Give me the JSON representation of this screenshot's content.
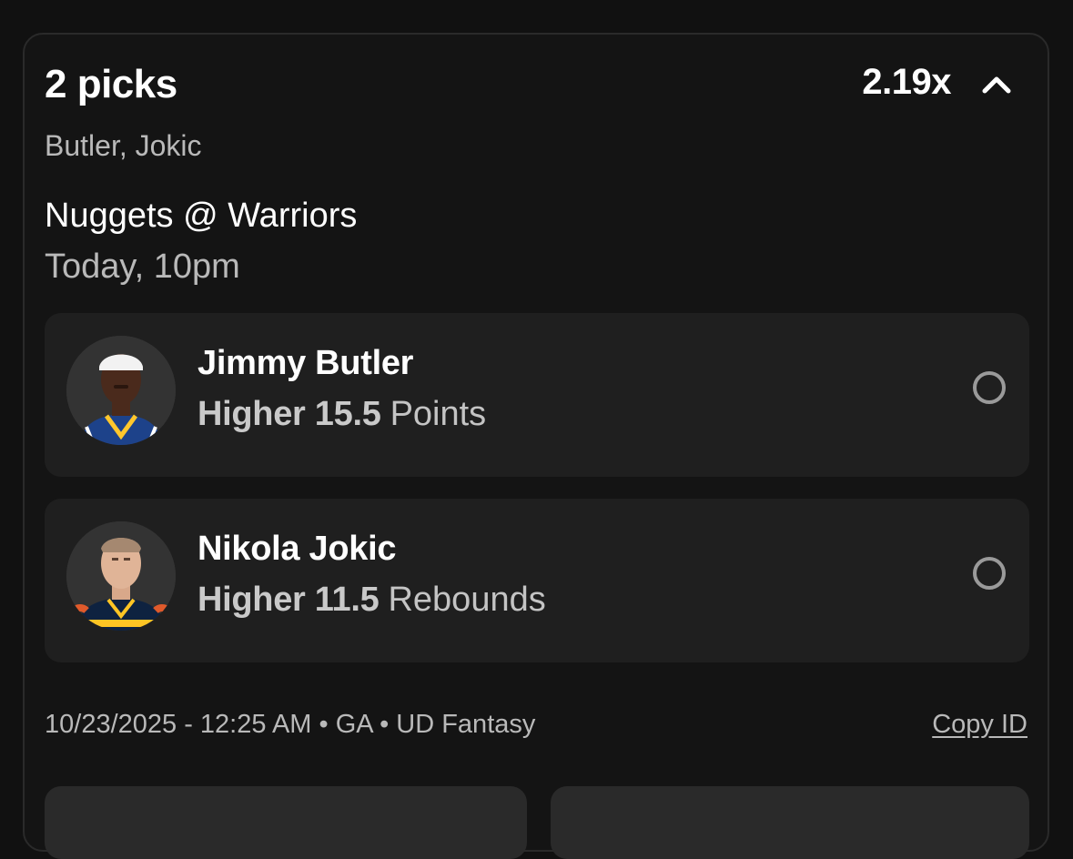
{
  "entry": {
    "picks_count_label": "2 picks",
    "multiplier": "2.19x",
    "players_summary": "Butler, Jokic",
    "matchup": "Nuggets @ Warriors",
    "game_time": "Today, 10pm"
  },
  "picks": [
    {
      "player": "Jimmy Butler",
      "direction": "Higher 15.5",
      "stat": "Points",
      "team_colors": {
        "jersey": "#1d428a",
        "accent": "#ffc72c"
      }
    },
    {
      "player": "Nikola Jokic",
      "direction": "Higher 11.5",
      "stat": "Rebounds",
      "team_colors": {
        "jersey": "#0e2240",
        "accent": "#fec524"
      }
    }
  ],
  "footer": {
    "meta": "10/23/2025 - 12:25 AM • GA • UD Fantasy",
    "copy_id_label": "Copy ID"
  },
  "icons": {
    "collapse": "chevron-up-icon",
    "pick_status": "radio-empty-icon"
  },
  "colors": {
    "background": "#111111",
    "card": "#141414",
    "pick_card": "#1f1f1f",
    "text_primary": "#ffffff",
    "text_secondary": "#b9b9b9"
  }
}
